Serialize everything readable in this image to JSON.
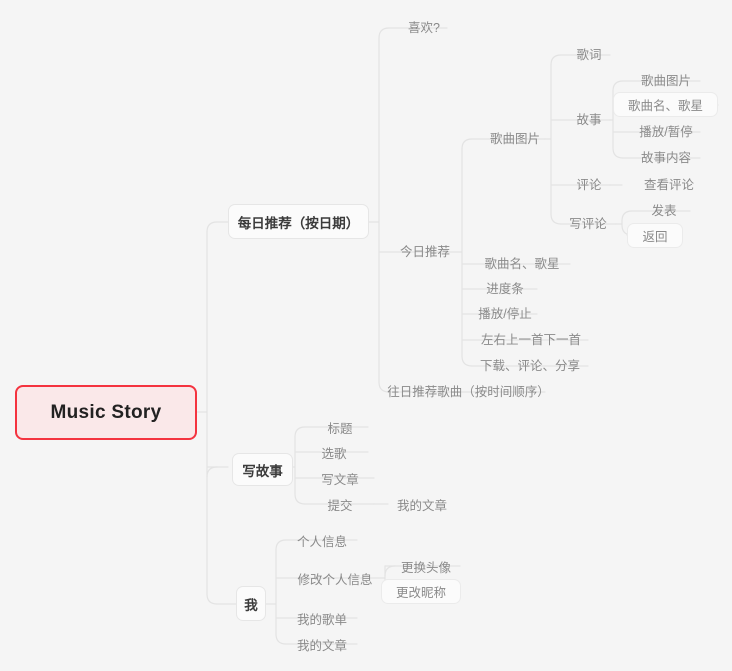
{
  "document": {
    "title": "Music Story",
    "type": "mind-map",
    "background_color": "#f5f5f5"
  },
  "colors": {
    "root_fill": "#fae8e9",
    "root_border": "#f4333f",
    "node_fill": "#fbfbfb",
    "node_border": "#e6e6e6",
    "connector": "#e3e3e3",
    "text_dark": "#3b3b3b",
    "text_muted": "#8a8a8a"
  },
  "nodes": {
    "root": "Music Story",
    "daily_recommend": "每日推荐（按日期）",
    "like": "喜欢?",
    "today_recommend": "今日推荐",
    "past_recommend": "往日推荐歌曲（按时间顺序）",
    "song_picture": "歌曲图片",
    "song_name_star": "歌曲名、歌星",
    "progress_bar": "进度条",
    "play_stop": "播放/停止",
    "prev_next": "左右上一首下一首",
    "download_comment_share": "下载、评论、分享",
    "lyrics": "歌词",
    "story": "故事",
    "comment": "评论",
    "write_comment": "写评论",
    "story_picture": "歌曲图片",
    "story_song_name_star": "歌曲名、歌星",
    "play_pause": "播放/暂停",
    "story_content": "故事内容",
    "view_comments": "查看评论",
    "publish": "发表",
    "back": "返回",
    "write_story": "写故事",
    "title_field": "标题",
    "pick_song": "选歌",
    "write_article": "写文章",
    "submit": "提交",
    "my_articles_from_submit": "我的文章",
    "me": "我",
    "personal_info": "个人信息",
    "edit_personal_info": "修改个人信息",
    "change_avatar": "更换头像",
    "change_nickname": "更改昵称",
    "my_playlist": "我的歌单",
    "my_articles": "我的文章"
  }
}
